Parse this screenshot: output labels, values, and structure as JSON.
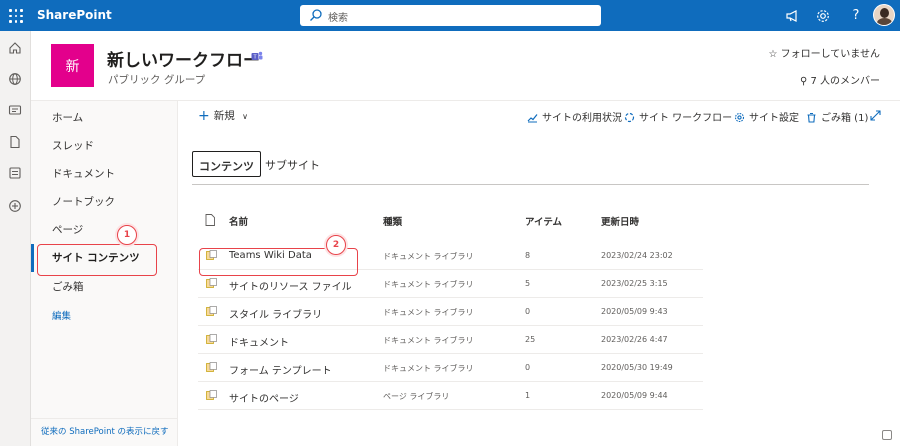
{
  "topbar": {
    "brand": "SharePoint",
    "search_placeholder": "検索",
    "icons": [
      "megaphone-icon",
      "gear-icon",
      "help-icon"
    ],
    "help_label": "?"
  },
  "rail": {
    "icons": [
      "home-icon",
      "globe-icon",
      "news-icon",
      "file-icon",
      "list-icon",
      "add-icon"
    ]
  },
  "site": {
    "logo_letter": "新",
    "title": "新しいワークフロー",
    "subtitle": "パブリック グループ",
    "follow": "☆ フォローしていません",
    "members": "7 人のメンバー"
  },
  "nav": {
    "items": [
      "ホーム",
      "スレッド",
      "ドキュメント",
      "ノートブック",
      "ページ",
      "サイト コンテンツ",
      "ごみ箱"
    ],
    "edit": "編集",
    "footer": "従来の SharePoint の表示に戻す"
  },
  "commands": {
    "new": "新規",
    "usage": "サイトの利用状況",
    "workflows": "サイト ワークフロー",
    "settings": "サイト設定",
    "recycle": "ごみ箱 (1)"
  },
  "tabs": [
    "コンテンツ",
    "サブサイト"
  ],
  "table": {
    "headers": {
      "name": "名前",
      "type": "種類",
      "items": "アイテム",
      "modified": "更新日時"
    },
    "rows": [
      {
        "name": "Teams Wiki Data",
        "type": "ドキュメント ライブラリ",
        "items": "8",
        "modified": "2023/02/24 23:02"
      },
      {
        "name": "サイトのリソース ファイル",
        "type": "ドキュメント ライブラリ",
        "items": "5",
        "modified": "2023/02/25 3:15"
      },
      {
        "name": "スタイル ライブラリ",
        "type": "ドキュメント ライブラリ",
        "items": "0",
        "modified": "2020/05/09 9:43"
      },
      {
        "name": "ドキュメント",
        "type": "ドキュメント ライブラリ",
        "items": "25",
        "modified": "2023/02/26 4:47"
      },
      {
        "name": "フォーム テンプレート",
        "type": "ドキュメント ライブラリ",
        "items": "0",
        "modified": "2020/05/30 19:49"
      },
      {
        "name": "サイトのページ",
        "type": "ページ ライブラリ",
        "items": "1",
        "modified": "2020/05/09 9:44"
      }
    ]
  },
  "annotations": [
    "1",
    "2"
  ],
  "colors": {
    "suite_bar": "#0f6cbd",
    "site_logo": "#e3008c",
    "annotation": "#e8434a",
    "accent": "#0f6cbd"
  }
}
